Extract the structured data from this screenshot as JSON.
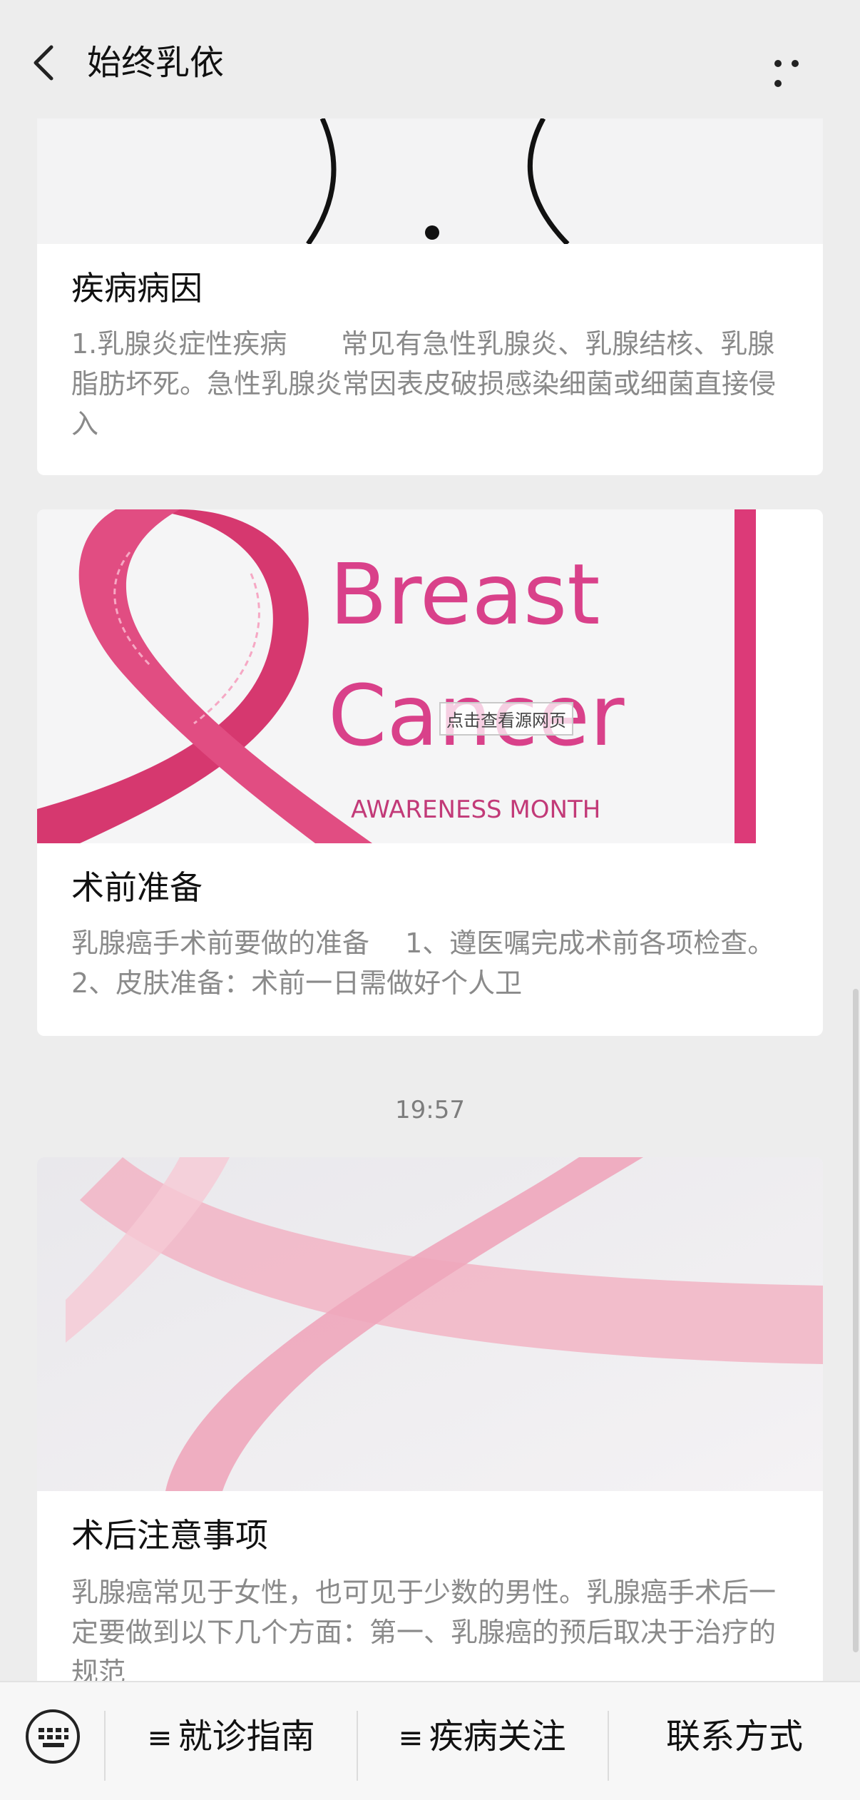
{
  "header": {
    "title": "始终乳依"
  },
  "cards": [
    {
      "title": "疾病病因",
      "desc": "1.乳腺炎症性疾病　　常见有急性乳腺炎、乳腺结核、乳腺脂肪坏死。急性乳腺炎常因表皮破损感染细菌或细菌直接侵入"
    },
    {
      "image": {
        "headline1": "Breast",
        "headline2": "Cancer",
        "subline": "AWARENESS MONTH",
        "overlay_link": "点击查看源网页"
      },
      "title": "术前准备",
      "desc": "乳腺癌手术前要做的准备　 1、遵医嘱完成术前各项检查。　 2、皮肤准备：术前一日需做好个人卫"
    },
    {
      "title": "术后注意事项",
      "desc": "乳腺癌常见于女性，也可见于少数的男性。乳腺癌手术后一定要做到以下几个方面：第一、乳腺癌的预后取决于治疗的规范"
    }
  ],
  "timestamp": "19:57",
  "bottom_menu": [
    {
      "label": "就诊指南",
      "has_submenu": true
    },
    {
      "label": "疾病关注",
      "has_submenu": true
    },
    {
      "label": "联系方式",
      "has_submenu": false
    }
  ],
  "colors": {
    "ribbon": "#d6386f",
    "headline": "#d9418a",
    "accent_bar": "#dc3a78",
    "light_ribbon": "#f2b7c6"
  }
}
